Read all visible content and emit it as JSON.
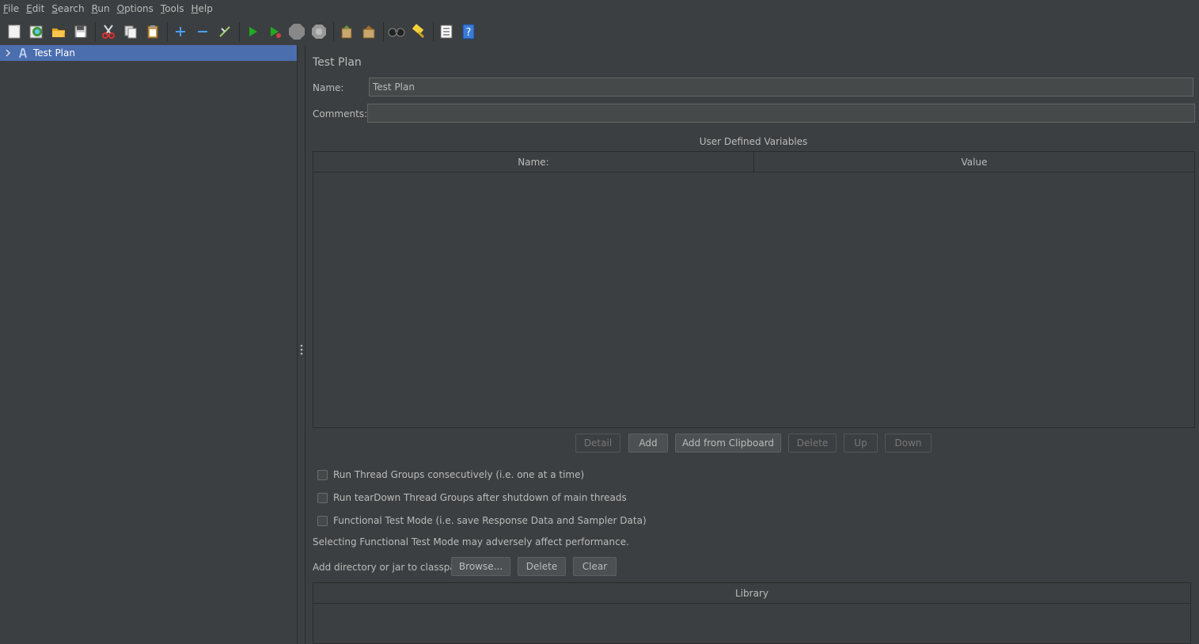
{
  "menu": {
    "items": [
      {
        "underline": "F",
        "rest": "ile"
      },
      {
        "underline": "E",
        "rest": "dit"
      },
      {
        "underline": "S",
        "rest": "earch"
      },
      {
        "underline": "R",
        "rest": "un"
      },
      {
        "underline": "O",
        "rest": "ptions"
      },
      {
        "underline": "T",
        "rest": "ools"
      },
      {
        "underline": "H",
        "rest": "elp"
      }
    ]
  },
  "toolbar": {
    "icons": [
      "new-icon",
      "templates-icon",
      "open-icon",
      "save-icon",
      "cut-icon",
      "copy-icon",
      "paste-icon",
      "expand-icon",
      "collapse-icon",
      "toggle-icon",
      "start-icon",
      "start-no-pause-icon",
      "stop-icon",
      "shutdown-icon",
      "clear-icon",
      "clear-all-icon",
      "search-icon",
      "reset-search-icon",
      "function-helper-icon",
      "help-icon"
    ]
  },
  "tree": {
    "root_label": "Test Plan"
  },
  "panel": {
    "title": "Test Plan",
    "name_label": "Name:",
    "name_value": "Test Plan",
    "comments_label": "Comments:",
    "comments_value": "",
    "udv_title": "User Defined Variables",
    "udv_columns": [
      "Name:",
      "Value"
    ],
    "buttons": {
      "detail": "Detail",
      "add": "Add",
      "add_clipboard": "Add from Clipboard",
      "delete": "Delete",
      "up": "Up",
      "down": "Down"
    },
    "checks": {
      "serialize": "Run Thread Groups consecutively (i.e. one at a time)",
      "teardown": "Run tearDown Thread Groups after shutdown of main threads",
      "functional": "Functional Test Mode (i.e. save Response Data and Sampler Data)"
    },
    "functional_warning": "Selecting Functional Test Mode may adversely affect performance.",
    "classpath_label": "Add directory or jar to classpath",
    "classpath_buttons": {
      "browse": "Browse...",
      "delete": "Delete",
      "clear": "Clear"
    },
    "library_column": "Library"
  }
}
